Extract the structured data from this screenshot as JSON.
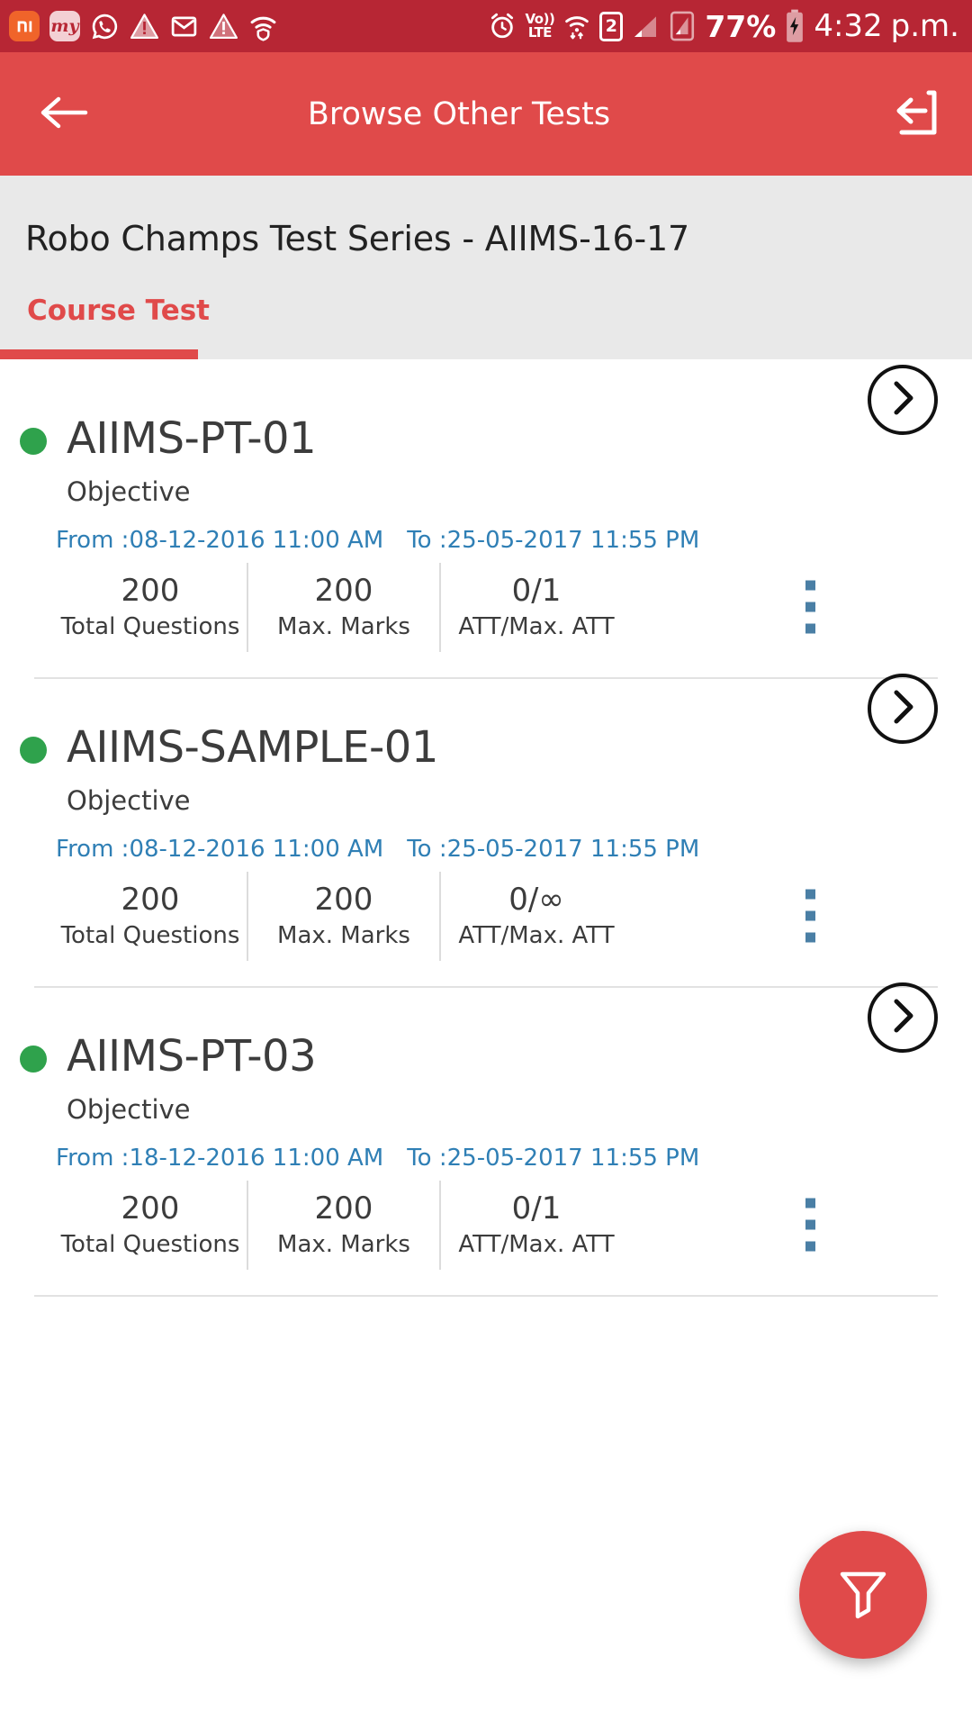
{
  "statusbar": {
    "icons_left": [
      "mi-icon",
      "my-icon",
      "whatsapp-icon",
      "warning-triangle-icon",
      "gmail-icon",
      "warning-triangle-icon-2",
      "wifi-shield-icon"
    ],
    "mi_label": "mi",
    "my_label": "my",
    "alarm_icon": "alarm-clock-icon",
    "volte_line1": "Vo))",
    "volte_line2": "LTE",
    "wifi_icon": "wifi-data-icon",
    "sim_label": "2",
    "signal_icon_1": "signal-bars-icon",
    "signal_icon_2": "signal-bars-boxed-icon",
    "battery_percent": "77%",
    "battery_icon": "battery-charging-icon",
    "time": "4:32",
    "meridiem": "p.m."
  },
  "appbar": {
    "back_icon": "back-arrow-icon",
    "title": "Browse Other Tests",
    "share_icon": "share-reply-icon"
  },
  "header": {
    "course_title": "Robo Champs Test Series - AIIMS-16-17"
  },
  "tabs": [
    {
      "label": "Course Test",
      "active": true
    }
  ],
  "colors": {
    "statusbar": "#b72634",
    "accent": "#e04a4a",
    "header_bg": "#e9e9e9",
    "date_text": "#2f7fb5",
    "status_dot": "#2fa24c",
    "kebab": "#4a7fa5"
  },
  "stat_labels": {
    "total_questions": "Total Questions",
    "max_marks": "Max. Marks",
    "attempts": "ATT/Max. ATT"
  },
  "tests": [
    {
      "name": "AIIMS-PT-01",
      "type": "Objective",
      "status": "active",
      "from": "From :08-12-2016 11:00 AM",
      "to": "To :25-05-2017 11:55 PM",
      "total_questions": "200",
      "max_marks": "200",
      "attempts": "0/1"
    },
    {
      "name": "AIIMS-SAMPLE-01",
      "type": "Objective",
      "status": "active",
      "from": "From :08-12-2016 11:00 AM",
      "to": "To :25-05-2017 11:55 PM",
      "total_questions": "200",
      "max_marks": "200",
      "attempts": "0/∞"
    },
    {
      "name": "AIIMS-PT-03",
      "type": "Objective",
      "status": "active",
      "from": "From :18-12-2016 11:00 AM",
      "to": "To :25-05-2017 11:55 PM",
      "total_questions": "200",
      "max_marks": "200",
      "attempts": "0/1"
    }
  ],
  "fab": {
    "icon": "filter-funnel-icon"
  }
}
